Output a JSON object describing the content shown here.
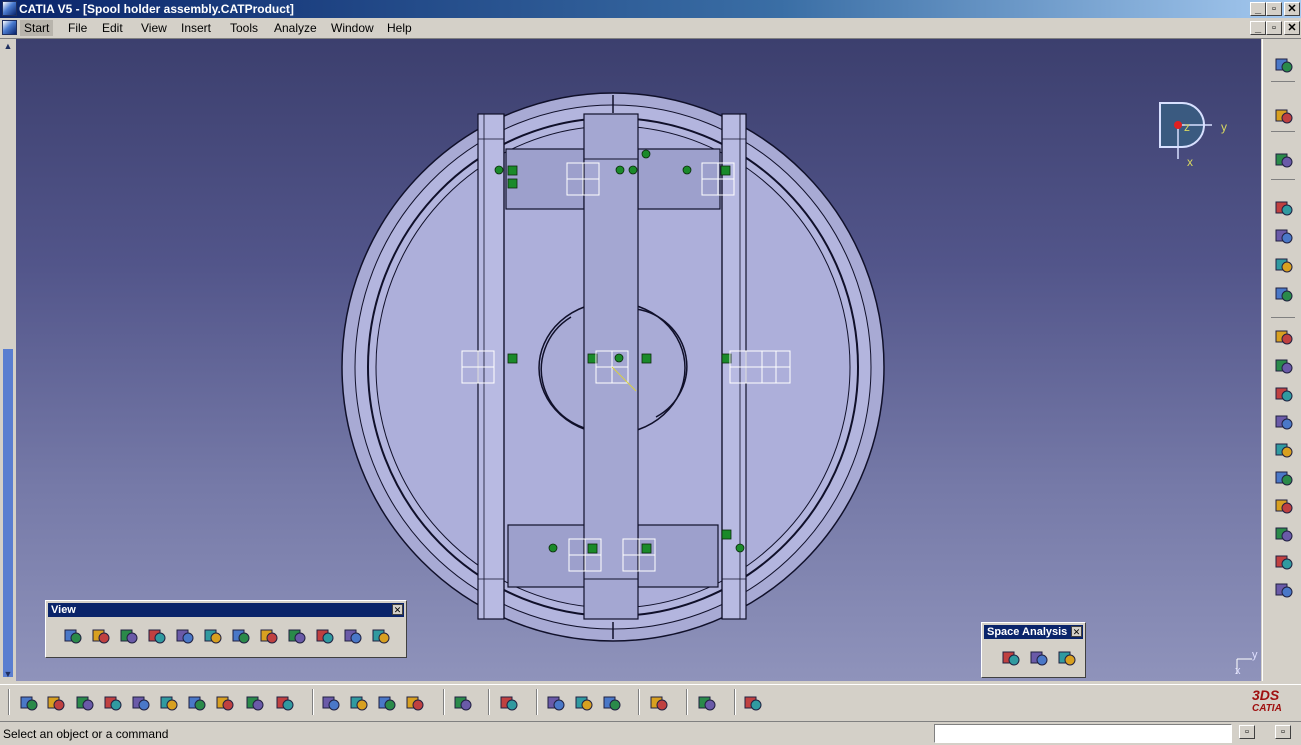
{
  "window": {
    "title": "CATIA V5 - [Spool holder assembly.CATProduct]"
  },
  "menu": [
    "Start",
    "File",
    "Edit",
    "View",
    "Insert",
    "Tools",
    "Analyze",
    "Window",
    "Help"
  ],
  "compass": {
    "z": "z",
    "y": "y",
    "x": "x"
  },
  "axis_mini": {
    "y": "y",
    "x": "x"
  },
  "view_toolbar": {
    "title": "View",
    "icons": [
      "fly-mode-icon",
      "fit-all-in-icon",
      "pan-icon",
      "rotate-icon",
      "zoom-in-icon",
      "zoom-out-icon",
      "normal-view-icon",
      "multi-view-icon",
      "quick-view-icon",
      "view-mode-icon",
      "hide-show-icon",
      "swap-visible-space-icon"
    ]
  },
  "space_analysis_toolbar": {
    "title": "Space Analysis",
    "icons": [
      "clash-icon",
      "sectioning-icon",
      "distance-band-analysis-icon"
    ]
  },
  "bottom_toolbar": {
    "icons": [
      "new-icon",
      "open-icon",
      "save-icon",
      "print-icon",
      "cut-icon",
      "copy-icon",
      "paste-icon",
      "undo-icon",
      "redo-icon",
      "whats-this-icon",
      "snap-icon",
      "manipulation-icon",
      "insert-existing-icon",
      "replace-icon",
      "capture-icon",
      "catalog-icon",
      "measure-between-icon",
      "measure-item-icon",
      "measure-inertia-icon",
      "update-icon",
      "publication-icon",
      "grid-icon"
    ]
  },
  "right_toolbar": {
    "icons": [
      "gear-assembly-icon",
      "select-arrow-icon",
      "move-icon",
      "insert-component-icon",
      "new-product-icon",
      "explode-icon",
      "smart-move-icon",
      "coincidence-icon",
      "contact-icon",
      "offset-icon",
      "angle-icon",
      "fix-icon",
      "fix-together-icon",
      "quick-constraint-icon",
      "flexible-rigid-icon",
      "update-constraint-icon",
      "reuse-pattern-icon"
    ]
  },
  "brand": {
    "logo_text": "CATIA"
  },
  "status": {
    "message": "Select an object or a command",
    "input_value": ""
  }
}
